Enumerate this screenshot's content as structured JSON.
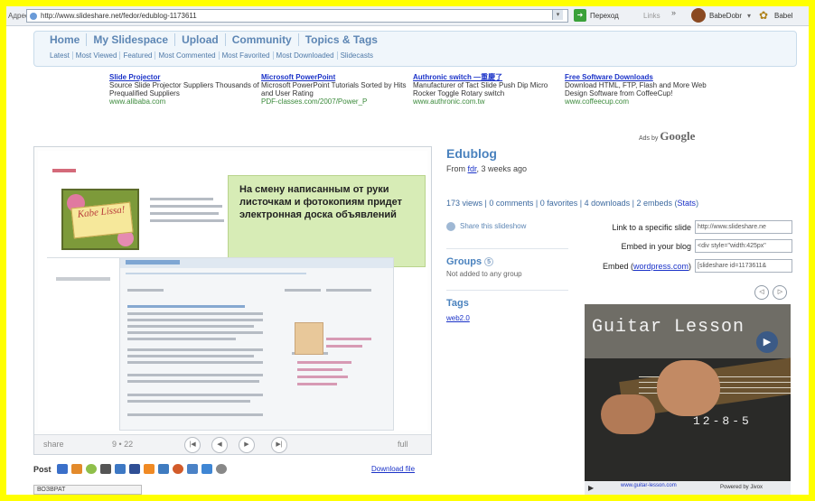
{
  "browser": {
    "address_label": "Адрес",
    "url": "http://www.slideshare.net/fedor/edublog-1173611",
    "go_label": "Переход",
    "links_label": "Links",
    "more": "»",
    "user1": "BabeDobr",
    "user1_drop": "▾",
    "user2": "Babel"
  },
  "nav": {
    "main": [
      "Home",
      "My Slidespace",
      "Upload",
      "Community",
      "Topics & Tags"
    ],
    "sub": [
      "Latest",
      "Most Viewed",
      "Featured",
      "Most Commented",
      "Most Favorited",
      "Most Downloaded",
      "Slidecasts"
    ]
  },
  "ads": [
    {
      "title": "Slide Projector",
      "body": "Source Slide Projector Suppliers Thousands of Prequalified Suppliers",
      "url": "www.alibaba.com"
    },
    {
      "title": "Microsoft PowerPoint",
      "body": "Microsoft PowerPoint Tutorials Sorted by Hits and User Rating",
      "url": "PDF-classes.com/2007/Power_P"
    },
    {
      "title": "Authronic switch —重慶了",
      "body": "Manufacturer of Tact Slide Push Dip Micro Rocker Toggle Rotary switch",
      "url": "www.authronic.com.tw"
    },
    {
      "title": "Free Software Downloads",
      "body": "Download HTML, FTP, Flash and More Web Design Software from CoffeeCup!",
      "url": "www.coffeecup.com"
    }
  ],
  "ads_by": {
    "prefix": "Ads by",
    "brand": "Google"
  },
  "slide": {
    "tooltip": "На смену написанным от руки листочкам и фотокопиям придет электронная доска объявлений",
    "pic_label": "Kabe Lissa!"
  },
  "controls": {
    "share": "share",
    "page": "9 • 22",
    "first": "|◀",
    "prev": "◀",
    "next": "▶",
    "last": "▶|",
    "full": "full"
  },
  "post": {
    "label": "Post",
    "download": "Download file"
  },
  "statusbar": "ВОЗВРАТ",
  "presentation": {
    "title": "Edublog",
    "by_prefix": "From",
    "author": "fdr",
    "age": ", 3 weeks ago",
    "stats": {
      "views": "173 views",
      "comments": "0 comments",
      "favorites": "0 favorites",
      "downloads": "4 downloads",
      "embeds": "2 embeds",
      "stats_link": "Stats"
    },
    "share_label": "Share this slideshow",
    "groups_title": "Groups",
    "groups_badge": "5",
    "groups_text": "Not added to any group",
    "tags_title": "Tags",
    "tag": "web2.0"
  },
  "embed": {
    "link_label": "Link to a specific slide",
    "link_value": "http://www.slideshare.ne",
    "blog_label": "Embed in your blog",
    "blog_value": "<div style=\"width:425px\"",
    "wp_label_pre": "Embed (",
    "wp_link": "wordpress.com",
    "wp_label_post": ")",
    "wp_value": "[slideshare id=1173611&",
    "prev": "◁",
    "next": "▷"
  },
  "video": {
    "title": "Guitar Lesson",
    "counter": "12-8-5",
    "url": "www.guitar-lesson.com",
    "provider": "Powered by Jivox",
    "play": "▶"
  }
}
